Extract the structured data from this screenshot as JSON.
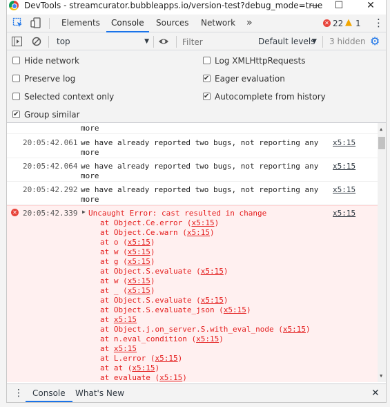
{
  "window": {
    "title": "DevTools - streamcurator.bubbleapps.io/version-test?debug_mode=true",
    "minimize": "—",
    "maximize": "☐",
    "close": "✕"
  },
  "tabs": {
    "items": [
      "Elements",
      "Console",
      "Sources",
      "Network"
    ],
    "more": "»",
    "error_count": "22",
    "warning_count": "1",
    "menu": "⋮"
  },
  "toolbar": {
    "context": "top",
    "filter_placeholder": "Filter",
    "levels": "Default levels",
    "hidden": "3 hidden"
  },
  "settings": {
    "hide_network": "Hide network",
    "preserve_log": "Preserve log",
    "selected_context": "Selected context only",
    "group_similar": "Group similar",
    "log_xhr": "Log XMLHttpRequests",
    "eager_eval": "Eager evaluation",
    "autocomplete": "Autocomplete from history",
    "checked": {
      "hide_network": false,
      "preserve_log": false,
      "selected_context": false,
      "group_similar": true,
      "log_xhr": false,
      "eager_eval": true,
      "autocomplete": true
    }
  },
  "console": {
    "first_line": "more",
    "logs": [
      {
        "time": "20:05:42.061",
        "msg": "we have already reported two bugs, not reporting any\nmore",
        "src": "x5:15"
      },
      {
        "time": "20:05:42.064",
        "msg": "we have already reported two bugs, not reporting any\nmore",
        "src": "x5:15"
      },
      {
        "time": "20:05:42.292",
        "msg": "we have already reported two bugs, not reporting any\nmore",
        "src": "x5:15"
      }
    ],
    "error": {
      "time": "20:05:42.339",
      "msg": "Uncaught Error: cast resulted in change",
      "src": "x5:15",
      "stack": [
        [
          "at Object.Ce.error (",
          "x5:15",
          ")"
        ],
        [
          "at Object.Ce.warn (",
          "x5:15",
          ")"
        ],
        [
          "at o (",
          "x5:15",
          ")"
        ],
        [
          "at w (",
          "x5:15",
          ")"
        ],
        [
          "at g (",
          "x5:15",
          ")"
        ],
        [
          "at Object.S.evaluate (",
          "x5:15",
          ")"
        ],
        [
          "at w (",
          "x5:15",
          ")"
        ],
        [
          "at _ (",
          "x5:15",
          ")"
        ],
        [
          "at Object.S.evaluate (",
          "x5:15",
          ")"
        ],
        [
          "at Object.S.evaluate_json (",
          "x5:15",
          ")"
        ],
        [
          "at ",
          "x5:15",
          ""
        ],
        [
          "at Object.j.on_server.S.with_eval_node (",
          "x5:15",
          ")"
        ],
        [
          "at n.eval_condition (",
          "x5:15",
          ")"
        ],
        [
          "at ",
          "x5:15",
          ""
        ],
        [
          "at L.error (",
          "x5:15",
          ")"
        ],
        [
          "at at (",
          "x5:15",
          ")"
        ],
        [
          "at evaluate (",
          "x5:15",
          ")"
        ]
      ]
    }
  },
  "drawer": {
    "tabs": [
      "Console",
      "What's New"
    ],
    "close": "✕"
  },
  "colors": {
    "accent": "#1a73e8",
    "error": "#e41c1c",
    "error_bg": "#fff0f0"
  }
}
